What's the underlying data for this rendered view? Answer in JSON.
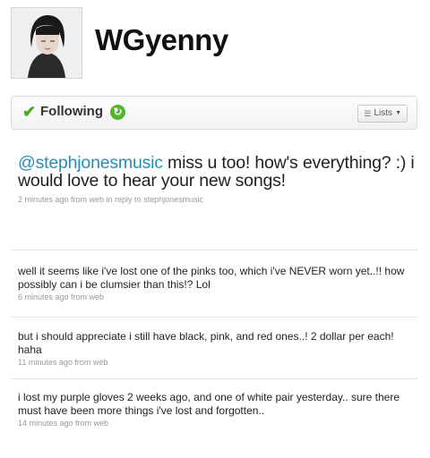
{
  "profile": {
    "username": "WGyenny",
    "avatar_icon": "profile-photo"
  },
  "follow_bar": {
    "following_label": "Following",
    "lists_label": "Lists",
    "accent": "#4caa1e"
  },
  "featured_tweet": {
    "mention": "@stephjonesmusic",
    "text": " miss u too! how's everything? :) i would love to hear your new songs!",
    "meta": "2 minutes ago from web in reply to stephjonesmusic",
    "mention_color": "#2a8db5"
  },
  "tweets": [
    {
      "text": "well it seems like i've lost one of the pinks too, which i've NEVER worn yet..!! how possibly can i be clumsier than this!? Lol",
      "meta": "6 minutes ago from web"
    },
    {
      "text": "but i should appreciate i still have black, pink, and red ones..! 2 dollar per each! haha",
      "meta": "11 minutes ago from web"
    },
    {
      "text": "i lost my purple gloves 2 weeks ago, and one of white pair yesterday.. sure there must have been more things i've lost and forgotten..",
      "meta": "14 minutes ago from web"
    }
  ]
}
